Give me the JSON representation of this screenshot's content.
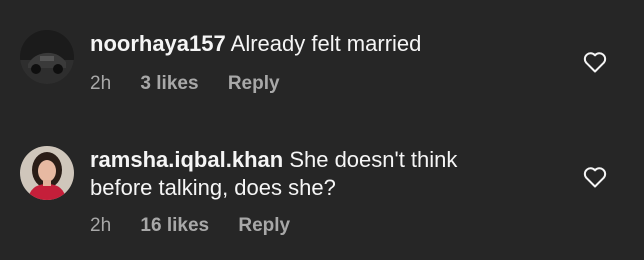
{
  "comments": [
    {
      "username": "noorhaya157",
      "text": "Already felt married",
      "time": "2h",
      "likes": "3 likes",
      "reply": "Reply",
      "avatar": "dark-car-avatar",
      "like_icon": "heart-outline-icon"
    },
    {
      "username": "ramsha.iqbal.khan",
      "text_line1": "She doesn't think",
      "text_line2": "before talking, does she?",
      "time": "2h",
      "likes": "16 likes",
      "reply": "Reply",
      "avatar": "woman-portrait-avatar",
      "like_icon": "heart-outline-icon"
    }
  ],
  "colors": {
    "background": "#262626",
    "primary_text": "#f5f5f5",
    "secondary_text": "#a8a8a8"
  }
}
